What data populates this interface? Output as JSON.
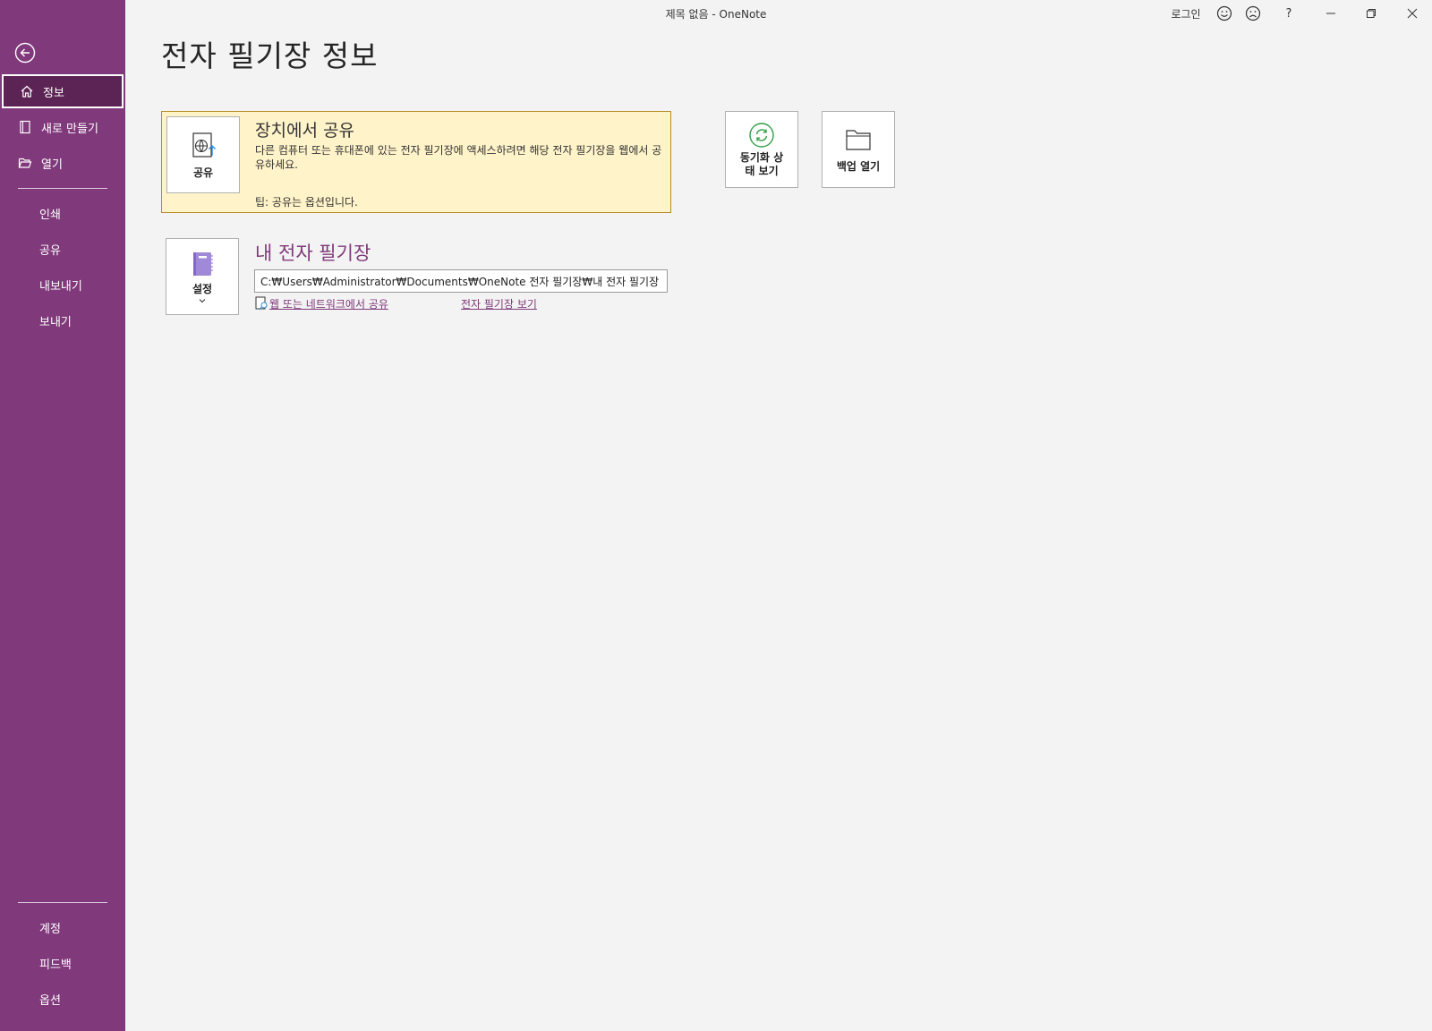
{
  "window": {
    "title": "제목 없음  -  OneNote",
    "signin_label": "로그인",
    "help_label": "?"
  },
  "sidebar": {
    "top_items": [
      {
        "label": "정보",
        "icon": "home-icon",
        "active": true
      },
      {
        "label": "새로 만들기",
        "icon": "new-notebook-icon"
      },
      {
        "label": "열기",
        "icon": "open-folder-icon"
      }
    ],
    "middle_items": [
      {
        "label": "인쇄"
      },
      {
        "label": "공유"
      },
      {
        "label": "내보내기"
      },
      {
        "label": "보내기"
      }
    ],
    "bottom_items": [
      {
        "label": "계정"
      },
      {
        "label": "피드백"
      },
      {
        "label": "옵션"
      }
    ]
  },
  "main": {
    "page_title": "전자 필기장 정보",
    "share_card": {
      "button_label": "공유",
      "heading": "장치에서 공유",
      "description": "다른 컴퓨터 또는 휴대폰에 있는 전자 필기장에 액세스하려면 해당 전자 필기장을 웹에서 공유하세요.",
      "tip": "팁: 공유는 옵션입니다."
    },
    "sync_button": {
      "line1": "동기화 상",
      "line2": "태 보기"
    },
    "backup_button": {
      "label": "백업 열기"
    },
    "notebook": {
      "settings_label": "설정",
      "name": "내 전자 필기장",
      "path": "C:₩Users₩Administrator₩Documents₩OneNote 전자 필기장₩내 전자 필기장",
      "share_link": "웹 또는 네트워크에서 공유",
      "view_link": "전자 필기장 보기"
    }
  },
  "colors": {
    "accent": "#80397b",
    "sidebar_active": "#5c2455",
    "share_card_bg": "#fff3c9",
    "sync_green": "#2f9e44"
  }
}
